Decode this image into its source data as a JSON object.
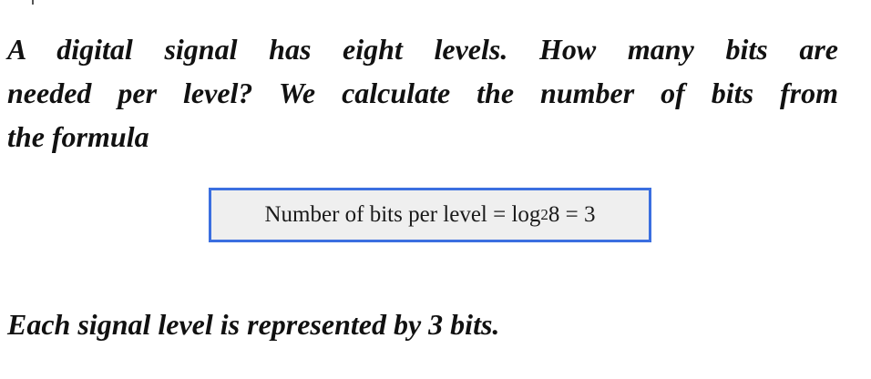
{
  "question": {
    "lines": [
      "A digital signal has eight levels. How many bits are",
      "needed per level? We calculate the number of bits from",
      "the formula"
    ]
  },
  "formula": {
    "lhs": "Number of bits per level = log",
    "subscript": "2",
    "rhs": " 8 = 3"
  },
  "answer": {
    "text": "Each signal level is represented by 3 bits."
  }
}
